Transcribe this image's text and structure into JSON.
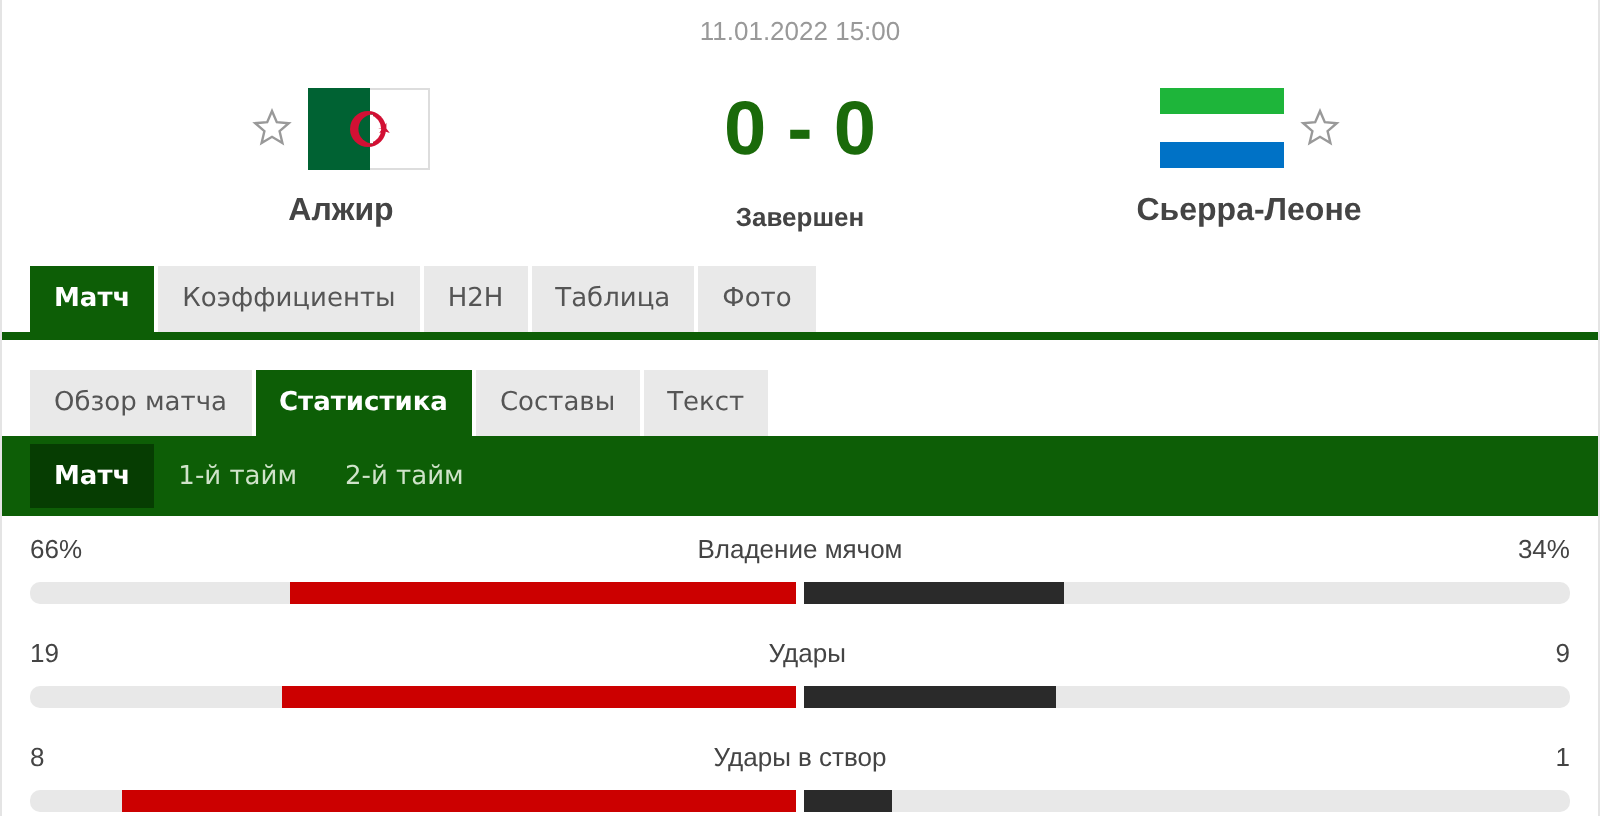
{
  "match": {
    "date": "11.01.2022 15:00",
    "score": "0 - 0",
    "status": "Завершен"
  },
  "teams": [
    {
      "name": "Алжир",
      "kind": "algeria"
    },
    {
      "name": "Сьерра-Леоне",
      "kind": "sierraleone"
    }
  ],
  "main_tabs": [
    {
      "label": "Матч",
      "selected": true
    },
    {
      "label": "Коэффициенты",
      "selected": false
    },
    {
      "label": "H2H",
      "selected": false
    },
    {
      "label": "Таблица",
      "selected": false
    },
    {
      "label": "Фото",
      "selected": false
    }
  ],
  "sub_tabs": [
    {
      "label": "Обзор матча",
      "selected": false
    },
    {
      "label": "Статистика",
      "selected": true
    },
    {
      "label": "Составы",
      "selected": false
    },
    {
      "label": "Текст",
      "selected": false
    }
  ],
  "period_tabs": [
    {
      "label": "Матч",
      "selected": true
    },
    {
      "label": "1-й тайм",
      "selected": false
    },
    {
      "label": "2-й тайм",
      "selected": false
    }
  ],
  "stats": [
    {
      "name": "Владение мячом",
      "home": {
        "value": "66%",
        "level": 0.66
      },
      "away": {
        "value": "34%",
        "level": 0.34
      }
    },
    {
      "name": "Удары",
      "home": {
        "value": "19",
        "level": 0.67
      },
      "away": {
        "value": "9",
        "level": 0.33
      }
    },
    {
      "name": "Удары в створ",
      "home": {
        "value": "8",
        "level": 0.88
      },
      "away": {
        "value": "1",
        "level": 0.115
      }
    }
  ]
}
